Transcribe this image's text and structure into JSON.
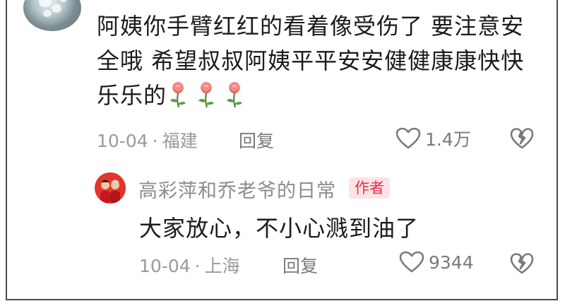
{
  "comment": {
    "text_line1": "阿姨你手臂红红的看着像受伤了 要注意安",
    "text_line2": "全哦 希望叔叔阿姨平平安安健健康康快快",
    "text_line3": "乐乐的",
    "emoji": [
      "rose",
      "rose",
      "rose"
    ],
    "date": "10-04",
    "separator": "·",
    "location": "福建",
    "reply_label": "回复",
    "likes": "1.4万"
  },
  "author_reply": {
    "author_name": "高彩萍和乔老爷的日常",
    "badge": "作者",
    "text": "大家放心，不小心溅到油了",
    "date": "10-04",
    "separator": "·",
    "location": "上海",
    "reply_label": "回复",
    "likes": "9344"
  },
  "colors": {
    "text": "#1b1b1b",
    "meta": "#9a9a9a",
    "badge_bg": "#fde3e6",
    "badge_text": "#ec2d4f"
  }
}
